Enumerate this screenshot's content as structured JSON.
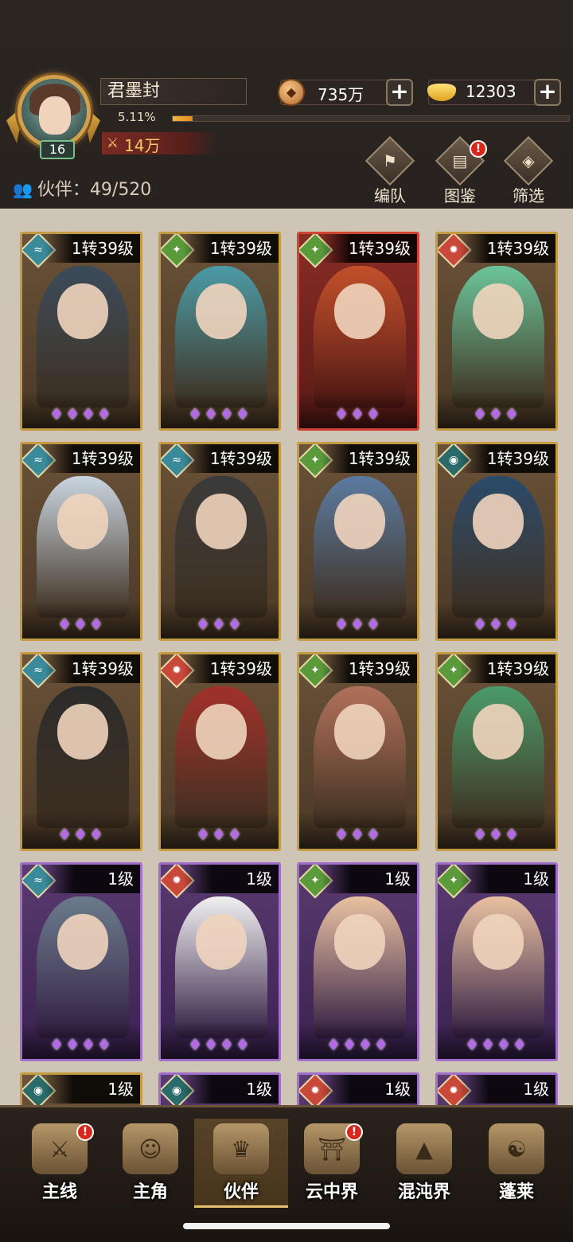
{
  "player": {
    "name": "君墨封",
    "level": "16",
    "exp_percent": "5.11%",
    "exp_fraction": 0.0511,
    "power": "14万"
  },
  "resources": {
    "coins": "735万",
    "gold": "12303",
    "plus": "+"
  },
  "partners": {
    "label": "伙伴：49/520"
  },
  "toolbar": {
    "formation": "编队",
    "codex": "图鉴",
    "filter": "筛选",
    "codex_badge": "!"
  },
  "cards": [
    {
      "level": "1转39级",
      "element": "wind",
      "stars": "♦♦♦♦",
      "rarity": "gold",
      "art_color": "#3a4a5a"
    },
    {
      "level": "1转39级",
      "element": "wood",
      "stars": "♦♦♦♦",
      "rarity": "gold",
      "art_color": "#4a9aa6"
    },
    {
      "level": "1转39级",
      "element": "wood",
      "stars": "♦♦♦",
      "rarity": "red",
      "art_color": "#c0502a"
    },
    {
      "level": "1转39级",
      "element": "fire",
      "stars": "♦♦♦",
      "rarity": "gold",
      "art_color": "#6ac49a"
    },
    {
      "level": "1转39级",
      "element": "wind",
      "stars": "♦♦♦",
      "rarity": "gold",
      "art_color": "#c8d4e0"
    },
    {
      "level": "1转39级",
      "element": "wind",
      "stars": "♦♦♦",
      "rarity": "gold",
      "art_color": "#3a3a3a"
    },
    {
      "level": "1转39级",
      "element": "wood",
      "stars": "♦♦♦",
      "rarity": "gold",
      "art_color": "#5a7aa0"
    },
    {
      "level": "1转39级",
      "element": "ghost",
      "stars": "♦♦♦",
      "rarity": "gold",
      "art_color": "#2a4a6a"
    },
    {
      "level": "1转39级",
      "element": "wind",
      "stars": "♦♦♦",
      "rarity": "gold",
      "art_color": "#2a2a2a"
    },
    {
      "level": "1转39级",
      "element": "fire",
      "stars": "♦♦♦",
      "rarity": "gold",
      "art_color": "#a0302a"
    },
    {
      "level": "1转39级",
      "element": "wood",
      "stars": "♦♦♦",
      "rarity": "gold",
      "art_color": "#b0705a"
    },
    {
      "level": "1转39级",
      "element": "wood",
      "stars": "♦♦♦",
      "rarity": "gold",
      "art_color": "#4a9a6a"
    },
    {
      "level": "1级",
      "element": "wind",
      "stars": "♦♦♦♦",
      "rarity": "purple",
      "art_color": "#6a7a8a"
    },
    {
      "level": "1级",
      "element": "fire",
      "stars": "♦♦♦♦",
      "rarity": "purple",
      "art_color": "#f0f0f0"
    },
    {
      "level": "1级",
      "element": "wood",
      "stars": "♦♦♦♦",
      "rarity": "purple",
      "art_color": "#e8c0a0"
    },
    {
      "level": "1级",
      "element": "wood",
      "stars": "♦♦♦♦",
      "rarity": "purple",
      "art_color": "#e8c0a0"
    },
    {
      "level": "1级",
      "element": "ghost",
      "stars": "",
      "rarity": "gold",
      "art_color": "#3a3a3a"
    },
    {
      "level": "1级",
      "element": "ghost",
      "stars": "",
      "rarity": "purple",
      "art_color": "#3a3a3a"
    },
    {
      "level": "1级",
      "element": "fire",
      "stars": "",
      "rarity": "purple",
      "art_color": "#3a3a3a"
    },
    {
      "level": "1级",
      "element": "fire",
      "stars": "",
      "rarity": "purple",
      "art_color": "#3a3a3a"
    }
  ],
  "nav": {
    "main_quest": "主线",
    "hero": "主角",
    "partner": "伙伴",
    "cloud_realm": "云中界",
    "chaos_realm": "混沌界",
    "penglai": "蓬莱",
    "badge": "!"
  },
  "colors": {
    "accent_gold": "#c49a42",
    "alert_red": "#d8281c",
    "purple_star": "#b46ae8"
  }
}
